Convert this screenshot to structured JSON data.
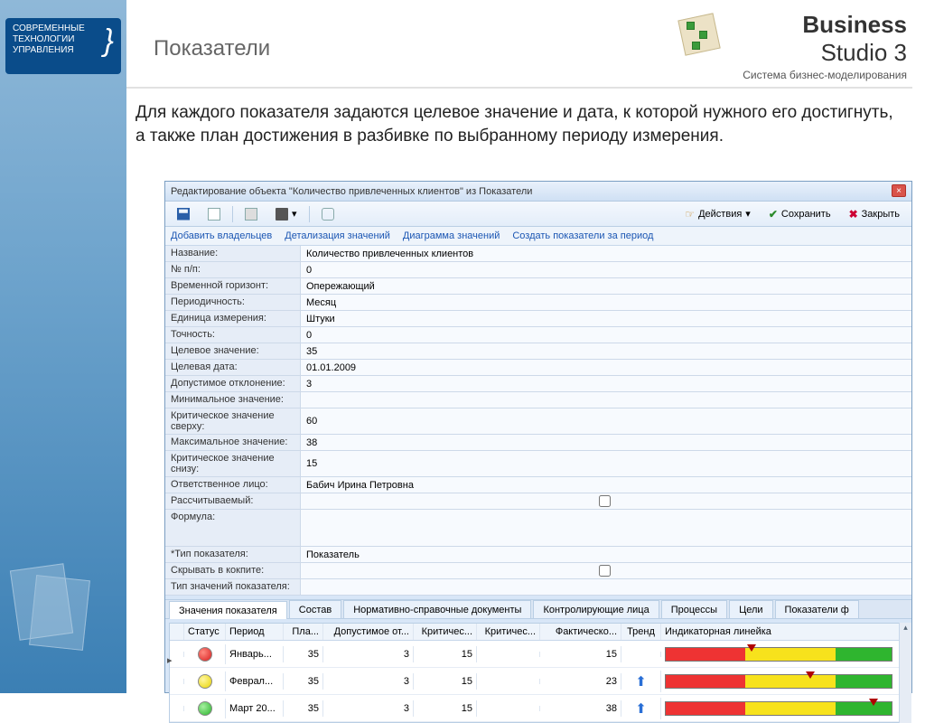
{
  "slide": {
    "title": "Показатели",
    "intro": "Для каждого показателя задаются целевое значение и дата, к которой нужного его достигнуть, а также план достижения  в разбивке по выбранному периоду измерения."
  },
  "brand": {
    "line1": "Business",
    "line2": "Studio 3",
    "sub": "Система бизнес-моделирования",
    "sidelogo_l1": "СОВРЕМЕННЫЕ",
    "sidelogo_l2": "ТЕХНОЛОГИИ",
    "sidelogo_l3": "УПРАВЛЕНИЯ"
  },
  "window": {
    "title": "Редактирование объекта \"Количество привлеченных клиентов\" из Показатели",
    "toolbar": {
      "actions": "Действия",
      "save": "Сохранить",
      "close": "Закрыть"
    },
    "links": {
      "add_owners": "Добавить владельцев",
      "detail": "Детализация значений",
      "chart": "Диаграмма значений",
      "create_period": "Создать показатели за период"
    },
    "form": {
      "name_label": "Название:",
      "name_value": "Количество привлеченных клиентов",
      "npp_label": "№ п/п:",
      "npp_value": "0",
      "horizon_label": "Временной горизонт:",
      "horizon_value": "Опережающий",
      "period_label": "Периодичность:",
      "period_value": "Месяц",
      "unit_label": "Единица измерения:",
      "unit_value": "Штуки",
      "precision_label": "Точность:",
      "precision_value": "0",
      "target_label": "Целевое значение:",
      "target_value": "35",
      "tdate_label": "Целевая дата:",
      "tdate_value": "01.01.2009",
      "deviation_label": "Допустимое отклонение:",
      "deviation_value": "3",
      "min_label": "Минимальное значение:",
      "min_value": "",
      "crit_up_label": "Критическое значение сверху:",
      "crit_up_value": "60",
      "max_label": "Максимальное значение:",
      "max_value": "38",
      "crit_down_label": "Критическое значение снизу:",
      "crit_down_value": "15",
      "resp_label": "Ответственное лицо:",
      "resp_value": "Бабич Ирина Петровна",
      "calc_label": "Рассчитываемый:",
      "formula_label": "Формула:",
      "type_label": "*Тип показателя:",
      "type_value": "Показатель",
      "hide_label": "Скрывать в кокпите:",
      "valtype_label": "Тип значений показателя:"
    },
    "tabs": {
      "values": "Значения показателя",
      "composition": "Состав",
      "docs": "Нормативно-справочные документы",
      "controllers": "Контролирующие лица",
      "processes": "Процессы",
      "goals": "Цели",
      "more": "Показатели ф"
    },
    "grid": {
      "hdr": {
        "status": "Статус",
        "period": "Период",
        "plan": "Пла...",
        "deviation": "Допустимое от...",
        "crit": "Критичес...",
        "crit2": "Критичес...",
        "fact": "Фактическо...",
        "trend": "Тренд",
        "indicator": "Индикаторная линейка"
      },
      "rows": [
        {
          "status": "red",
          "period": "Январь...",
          "plan": "35",
          "dev": "3",
          "crit": "15",
          "crit2": "",
          "fact": "15",
          "trend": "",
          "mark": 36
        },
        {
          "status": "yellow",
          "period": "Феврал...",
          "plan": "35",
          "dev": "3",
          "crit": "15",
          "crit2": "",
          "fact": "23",
          "trend": "up",
          "mark": 62
        },
        {
          "status": "green",
          "period": "Март 20...",
          "plan": "35",
          "dev": "3",
          "crit": "15",
          "crit2": "",
          "fact": "38",
          "trend": "up",
          "mark": 90
        }
      ]
    }
  }
}
